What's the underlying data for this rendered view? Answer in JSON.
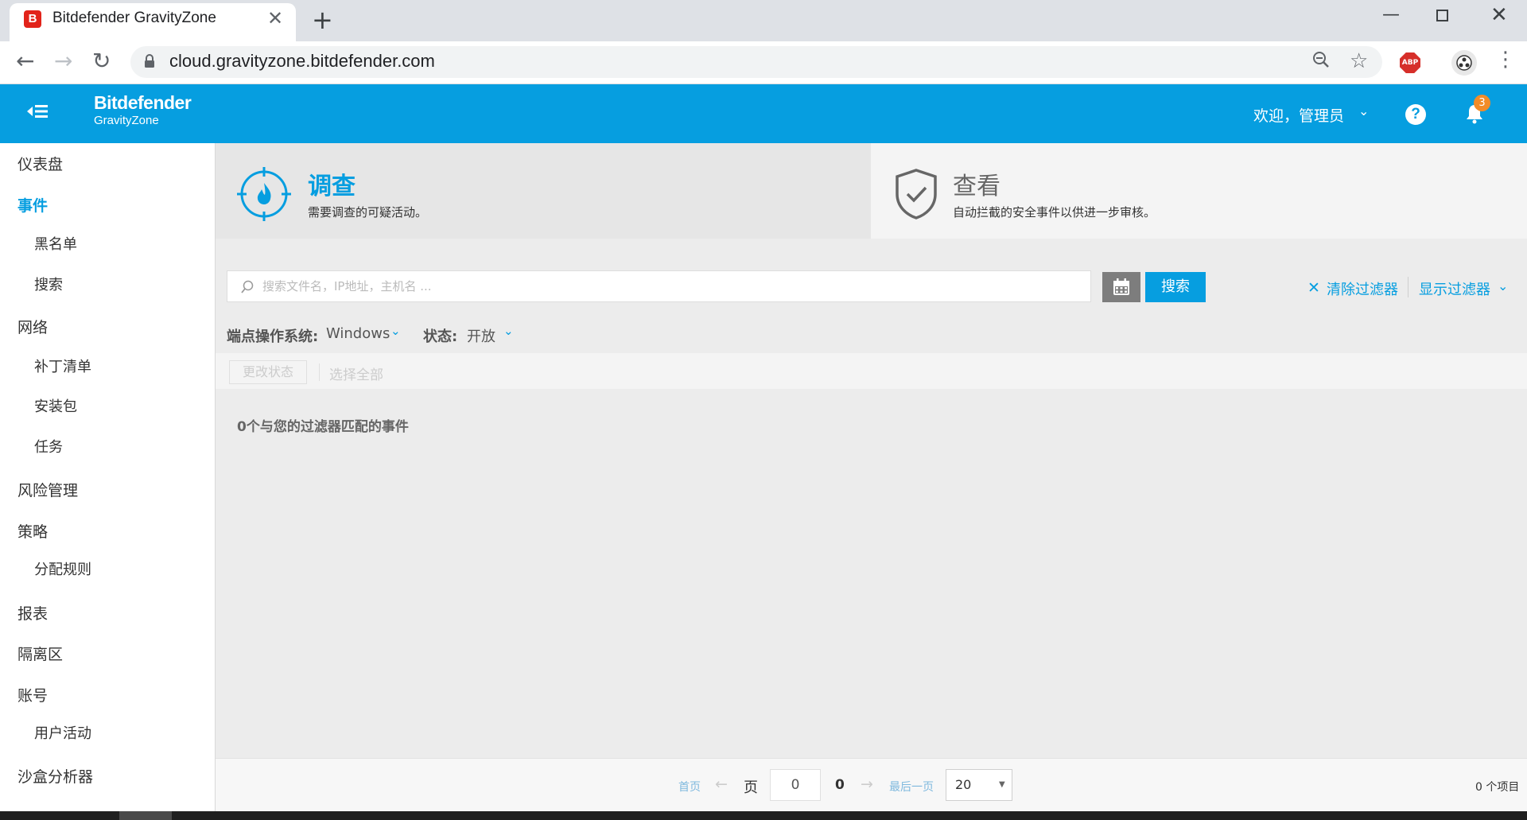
{
  "browser": {
    "tab_title": "Bitdefender GravityZone",
    "tab_favicon": "B",
    "url": "cloud.gravityzone.bitdefender.com",
    "ext_abp": "ABP"
  },
  "header": {
    "brand_name": "Bitdefender",
    "brand_product": "GravityZone",
    "welcome": "欢迎，管理员",
    "help": "?",
    "notifications_count": "3"
  },
  "sidebar": {
    "items": [
      {
        "label": "仪表盘"
      },
      {
        "label": "事件"
      },
      {
        "label": "黑名单"
      },
      {
        "label": "搜索"
      },
      {
        "label": "网络"
      },
      {
        "label": "补丁清单"
      },
      {
        "label": "安装包"
      },
      {
        "label": "任务"
      },
      {
        "label": "风险管理"
      },
      {
        "label": "策略"
      },
      {
        "label": "分配规则"
      },
      {
        "label": "报表"
      },
      {
        "label": "隔离区"
      },
      {
        "label": "账号"
      },
      {
        "label": "用户活动"
      },
      {
        "label": "沙盒分析器"
      }
    ]
  },
  "cards": {
    "investigate": {
      "title": "调查",
      "desc": "需要调查的可疑活动。"
    },
    "review": {
      "title": "查看",
      "desc": "自动拦截的安全事件以供进一步审核。"
    }
  },
  "search": {
    "placeholder": "搜索文件名，IP地址，主机名 ...",
    "button": "搜索",
    "clear_filters": "清除过滤器",
    "show_filters": "显示过滤器"
  },
  "filters": {
    "os_label": "端点操作系统:",
    "os_value": "Windows",
    "status_label": "状态:",
    "status_value": "开放"
  },
  "actions": {
    "change_status": "更改状态",
    "select_all": "选择全部"
  },
  "results": {
    "empty_message": "0个与您的过滤器匹配的事件"
  },
  "pagination": {
    "first": "首页",
    "prev_arrow": "←",
    "page_label": "页",
    "current_page": "0",
    "total_pages": "0",
    "next_arrow": "→",
    "last": "最后一页",
    "page_size": "20",
    "item_count": "0 个项目"
  },
  "colors": {
    "brand_blue": "#069ee0",
    "abp_red": "#d62f2a",
    "badge_orange": "#f28c28"
  }
}
